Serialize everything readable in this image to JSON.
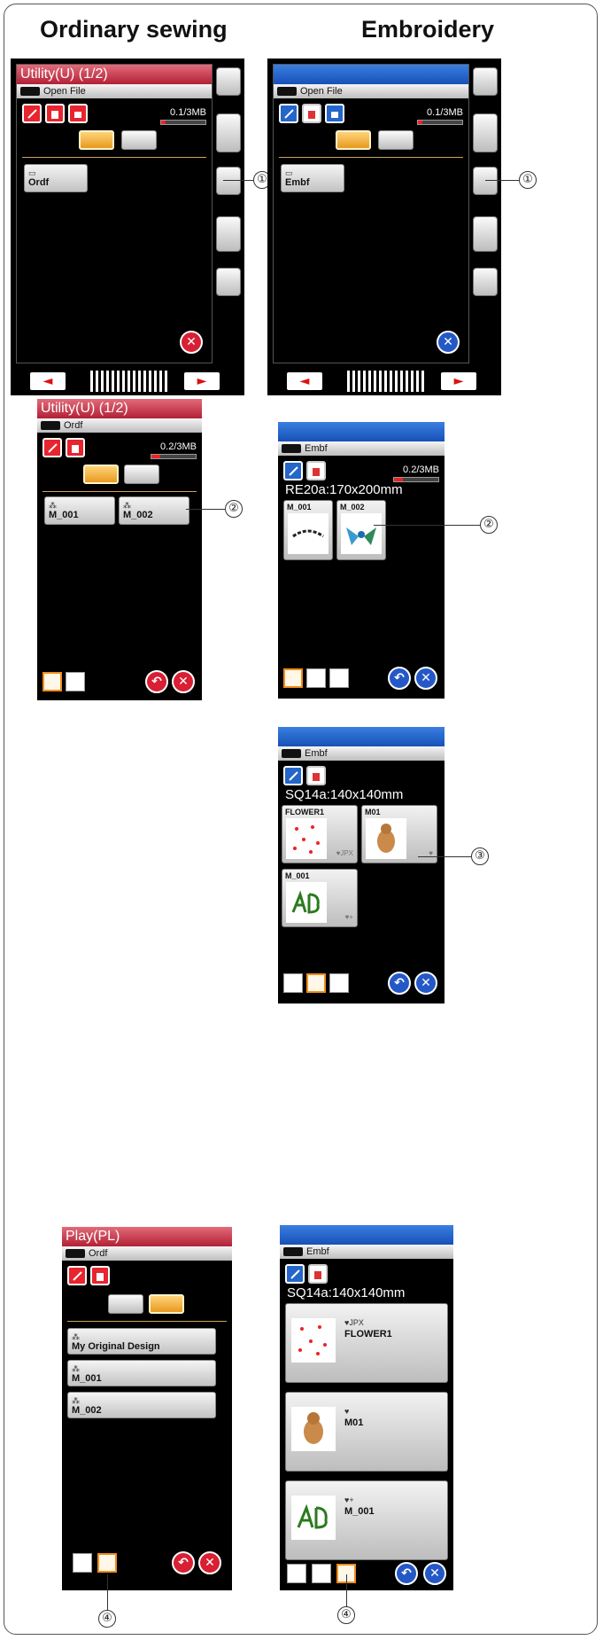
{
  "headers": {
    "left": "Ordinary sewing",
    "right": "Embroidery"
  },
  "panel1_left": {
    "title": "Utility(U) (1/2)",
    "path": "Open File",
    "memory": "0.1/3MB",
    "memory_fraction": 0.1,
    "folder_icon_glyph": "▭",
    "folder": "Ordf"
  },
  "panel1_right": {
    "title": "",
    "path": "Open File",
    "memory": "0.1/3MB",
    "memory_fraction": 0.1,
    "folder_icon_glyph": "▭",
    "folder": "Embf"
  },
  "panel2_left": {
    "title": "Utility(U) (1/2)",
    "path": "Ordf",
    "memory": "0.2/3MB",
    "memory_fraction": 0.2,
    "file_icon_glyph": "⁂",
    "files": [
      "M_001",
      "M_002"
    ]
  },
  "panel2_right": {
    "title": "",
    "path": "Embf",
    "memory": "0.2/3MB",
    "memory_fraction": 0.2,
    "hoop": "RE20a:170x200mm",
    "files": [
      "M_001",
      "M_002"
    ]
  },
  "panel3_right": {
    "title": "",
    "path": "Embf",
    "hoop": "SQ14a:140x140mm",
    "files": [
      {
        "name": "FLOWER1",
        "tag": "♥JPX"
      },
      {
        "name": "M01",
        "tag": "♥"
      },
      {
        "name": "M_001",
        "tag": "♥+"
      }
    ]
  },
  "panel4_left": {
    "title": "Play(PL)",
    "path": "Ordf",
    "file_icon_glyph": "⁂",
    "files": [
      "My Original Design",
      "M_001",
      "M_002"
    ]
  },
  "panel4_right": {
    "title": "",
    "path": "Embf",
    "hoop": "SQ14a:140x140mm",
    "files": [
      {
        "name": "FLOWER1",
        "tag": "♥JPX"
      },
      {
        "name": "M01",
        "tag": "♥"
      },
      {
        "name": "M_001",
        "tag": "♥+"
      }
    ]
  },
  "callouts": {
    "one": "①",
    "two": "②",
    "three": "③",
    "four": "④"
  },
  "glyphs": {
    "close": "✕",
    "back": "↶",
    "arrow_left": "◄",
    "arrow_right": "►"
  },
  "colors": {
    "ordinary_title": "#c8283c",
    "embroidery_title": "#2a64c8",
    "accent_orange": "#f28c1c"
  }
}
